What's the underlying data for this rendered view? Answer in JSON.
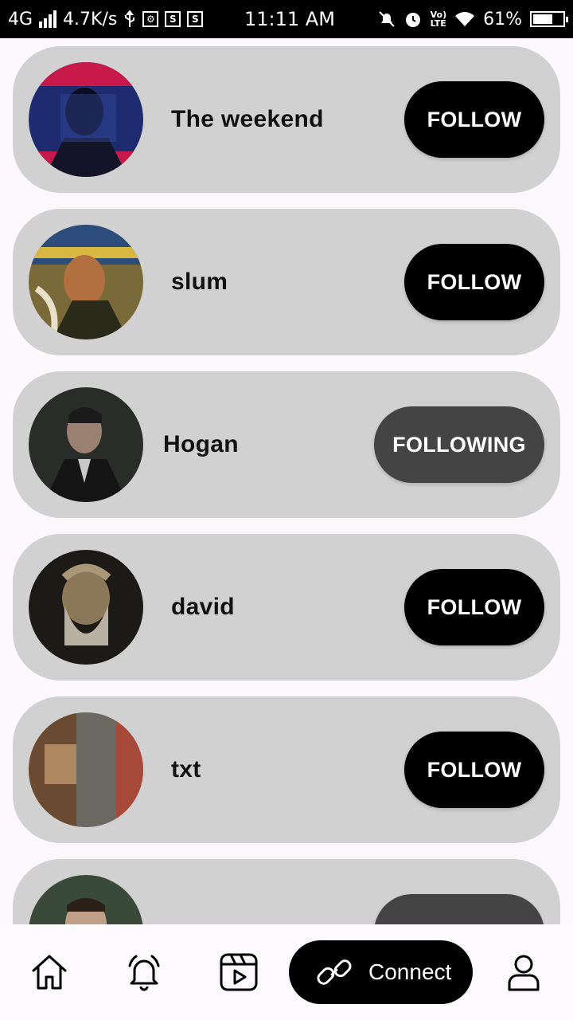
{
  "status_bar": {
    "network": "4G",
    "speed": "4.7K/s",
    "time": "11:11 AM",
    "battery": "61%"
  },
  "users": [
    {
      "name": "The weekend",
      "button": "FOLLOW",
      "state": "follow"
    },
    {
      "name": "slum",
      "button": "FOLLOW",
      "state": "follow"
    },
    {
      "name": "Hogan",
      "button": "FOLLOWING",
      "state": "following"
    },
    {
      "name": "david",
      "button": "FOLLOW",
      "state": "follow"
    },
    {
      "name": "txt",
      "button": "FOLLOW",
      "state": "follow"
    },
    {
      "name": "",
      "button": "",
      "state": "following"
    }
  ],
  "bottom_nav": {
    "items": [
      "home-icon",
      "bell-icon",
      "video-icon",
      "link-icon",
      "profile-icon"
    ],
    "active_label": "Connect"
  }
}
